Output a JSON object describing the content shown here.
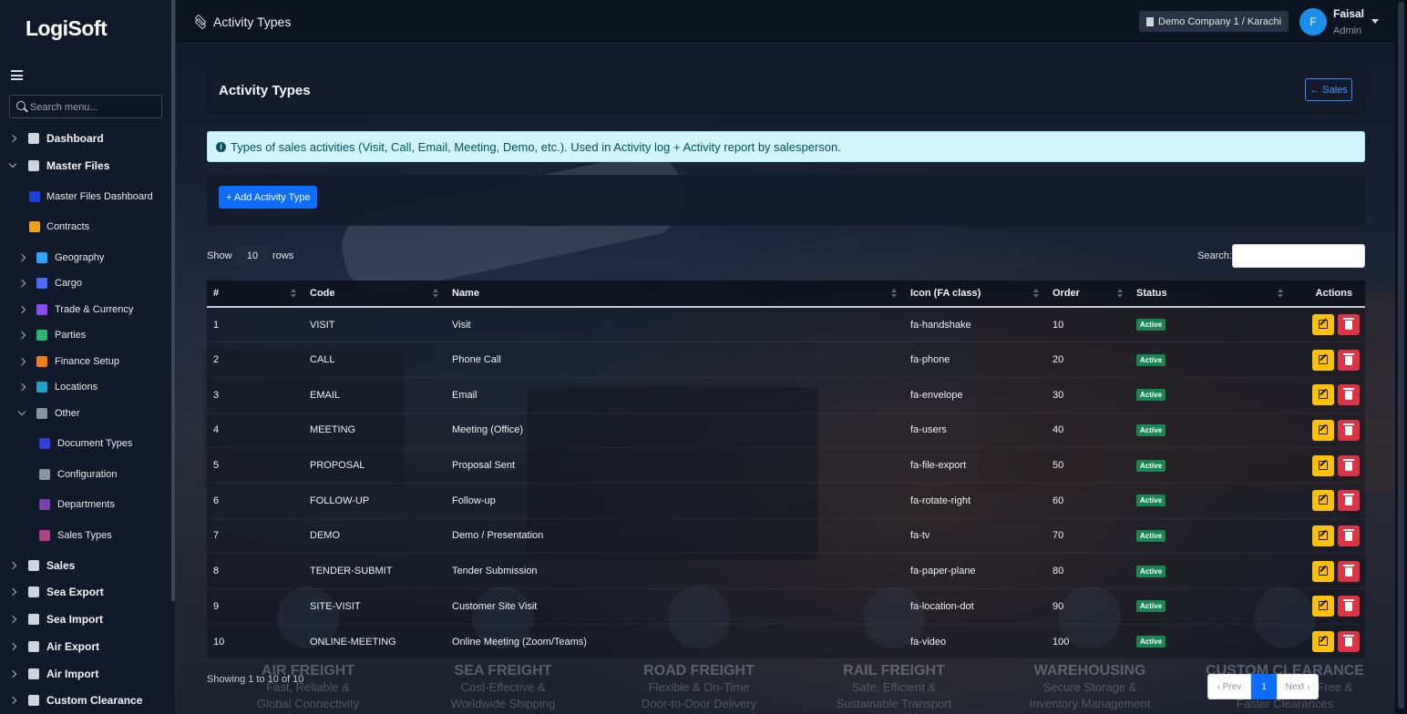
{
  "app": {
    "logo_text_a": "Logi",
    "logo_text_b": "Soft"
  },
  "sidebar": {
    "search_placeholder": "Search menu...",
    "items": [
      {
        "label": "Dashboard",
        "level": 0,
        "expanded": false,
        "icon": "chart-line-icon",
        "color": "#cfd5df"
      },
      {
        "label": "Master Files",
        "level": 0,
        "expanded": true,
        "icon": "database-icon",
        "color": "#cfd5df"
      },
      {
        "label": "Master Files Dashboard",
        "level": 1,
        "icon": "gauge-icon",
        "color": "#1e3fd6"
      },
      {
        "label": "Contracts",
        "level": 1,
        "icon": "file-contract-icon",
        "color": "#f0a21b"
      },
      {
        "label": "Geography",
        "level": 2,
        "expanded": false,
        "icon": "globe-icon",
        "color": "#2fa4ff"
      },
      {
        "label": "Cargo",
        "level": 2,
        "expanded": false,
        "icon": "box-icon",
        "color": "#4a6cf7"
      },
      {
        "label": "Trade & Currency",
        "level": 2,
        "expanded": false,
        "icon": "handshake-icon",
        "color": "#8a4df0"
      },
      {
        "label": "Parties",
        "level": 2,
        "expanded": false,
        "icon": "users-icon",
        "color": "#2bb673"
      },
      {
        "label": "Finance Setup",
        "level": 2,
        "expanded": false,
        "icon": "coins-icon",
        "color": "#f07d1b"
      },
      {
        "label": "Locations",
        "level": 2,
        "expanded": false,
        "icon": "warehouse-icon",
        "color": "#1fa2c9"
      },
      {
        "label": "Other",
        "level": 2,
        "expanded": true,
        "icon": "tags-icon",
        "color": "#8a93a1"
      },
      {
        "label": "Document Types",
        "level": 3,
        "icon": "file-lines-icon",
        "color": "#2f3fd6"
      },
      {
        "label": "Configuration",
        "level": 3,
        "icon": "sliders-icon",
        "color": "#8a93a1"
      },
      {
        "label": "Departments",
        "level": 3,
        "icon": "sitemap-icon",
        "color": "#7a3fb0"
      },
      {
        "label": "Sales Types",
        "level": 3,
        "icon": "chart-area-icon",
        "color": "#b03f8c"
      },
      {
        "label": "Sales",
        "level": 0,
        "expanded": false,
        "icon": "handshake-icon",
        "color": "#cfd5df"
      },
      {
        "label": "Sea Export",
        "level": 0,
        "expanded": false,
        "icon": "anchor-icon",
        "color": "#cfd5df"
      },
      {
        "label": "Sea Import",
        "level": 0,
        "expanded": false,
        "icon": "ship-icon",
        "color": "#cfd5df"
      },
      {
        "label": "Air Export",
        "level": 0,
        "expanded": false,
        "icon": "plane-departure-icon",
        "color": "#cfd5df"
      },
      {
        "label": "Air Import",
        "level": 0,
        "expanded": false,
        "icon": "plane-arrival-icon",
        "color": "#cfd5df"
      },
      {
        "label": "Custom Clearance",
        "level": 0,
        "expanded": false,
        "icon": "file-shield-icon",
        "color": "#cfd5df"
      }
    ]
  },
  "header": {
    "page_title": "Activity Types",
    "company": "Demo Company 1 / Karachi",
    "user_initial": "F",
    "user_name": "Faisal",
    "user_role": "Admin"
  },
  "card": {
    "title": "Activity Types",
    "back_label": "Sales",
    "info_text": "Types of sales activities (Visit, Call, Email, Meeting, Demo, etc.). Used in Activity log + Activity report by salesperson.",
    "add_label": "+ Add Activity Type"
  },
  "table_controls": {
    "show_label": "Show",
    "rows_value": "10",
    "rows_label": "rows",
    "search_label": "Search:",
    "search_value": ""
  },
  "table": {
    "columns": [
      "#",
      "Code",
      "Name",
      "Icon (FA class)",
      "Order",
      "Status",
      "Actions"
    ],
    "rows": [
      {
        "n": "1",
        "code": "VISIT",
        "name": "Visit",
        "icon": "fa-handshake",
        "order": "10",
        "status": "Active"
      },
      {
        "n": "2",
        "code": "CALL",
        "name": "Phone Call",
        "icon": "fa-phone",
        "order": "20",
        "status": "Active"
      },
      {
        "n": "3",
        "code": "EMAIL",
        "name": "Email",
        "icon": "fa-envelope",
        "order": "30",
        "status": "Active"
      },
      {
        "n": "4",
        "code": "MEETING",
        "name": "Meeting (Office)",
        "icon": "fa-users",
        "order": "40",
        "status": "Active"
      },
      {
        "n": "5",
        "code": "PROPOSAL",
        "name": "Proposal Sent",
        "icon": "fa-file-export",
        "order": "50",
        "status": "Active"
      },
      {
        "n": "6",
        "code": "FOLLOW-UP",
        "name": "Follow-up",
        "icon": "fa-rotate-right",
        "order": "60",
        "status": "Active"
      },
      {
        "n": "7",
        "code": "DEMO",
        "name": "Demo / Presentation",
        "icon": "fa-tv",
        "order": "70",
        "status": "Active"
      },
      {
        "n": "8",
        "code": "TENDER-SUBMIT",
        "name": "Tender Submission",
        "icon": "fa-paper-plane",
        "order": "80",
        "status": "Active"
      },
      {
        "n": "9",
        "code": "SITE-VISIT",
        "name": "Customer Site Visit",
        "icon": "fa-location-dot",
        "order": "90",
        "status": "Active"
      },
      {
        "n": "10",
        "code": "ONLINE-MEETING",
        "name": "Online Meeting (Zoom/Teams)",
        "icon": "fa-video",
        "order": "100",
        "status": "Active"
      }
    ],
    "info": "Showing 1 to 10 of 10",
    "pager": {
      "prev": "‹ Prev",
      "current": "1",
      "next": "Next ›"
    }
  },
  "background_services": [
    {
      "title": "AIR FREIGHT",
      "sub1": "Fast, Reliable &",
      "sub2": "Global Connectivity"
    },
    {
      "title": "SEA FREIGHT",
      "sub1": "Cost-Effective &",
      "sub2": "Worldwide Shipping"
    },
    {
      "title": "ROAD FREIGHT",
      "sub1": "Flexible & On-Time",
      "sub2": "Door-to-Door Delivery"
    },
    {
      "title": "RAIL FREIGHT",
      "sub1": "Safe, Efficient &",
      "sub2": "Sustainable Transport"
    },
    {
      "title": "WAREHOUSING",
      "sub1": "Secure Storage &",
      "sub2": "Inventory Management"
    },
    {
      "title": "CUSTOM CLEARANCE",
      "sub1": "Compliant, Hassle-Free &",
      "sub2": "Faster Clearances"
    }
  ],
  "colors": {
    "primary": "#0d6efd",
    "success": "#198754",
    "warning": "#ffc107",
    "danger": "#dc3545",
    "info_bg": "#cff4fc"
  }
}
